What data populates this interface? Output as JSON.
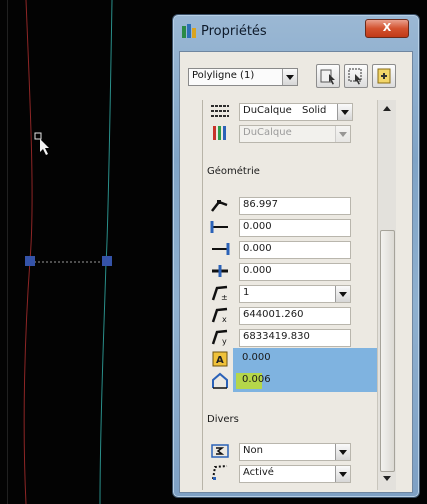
{
  "window": {
    "title": "Propriétés",
    "close_label": "X"
  },
  "toolbar": {
    "object_type": "Polyligne (1)",
    "buttons": [
      "quick-select-icon",
      "select-objects-icon",
      "toggle-pickadd-icon"
    ]
  },
  "general": {
    "rows": [
      {
        "icon": "linetype-icon",
        "value": "DuCalque",
        "extra": "Solid"
      },
      {
        "icon": "plotstyle-icon",
        "value": "DuCalque"
      }
    ]
  },
  "geometry": {
    "label": "Géométrie",
    "rows": [
      {
        "icon": "vertex-icon",
        "value": "86.997",
        "type": "text"
      },
      {
        "icon": "start-segment-width-icon",
        "value": "0.000",
        "type": "text"
      },
      {
        "icon": "end-segment-width-icon",
        "value": "0.000",
        "type": "text"
      },
      {
        "icon": "global-width-icon",
        "value": "0.000",
        "type": "text"
      },
      {
        "icon": "current-vertex-icon",
        "value": "1",
        "type": "select"
      },
      {
        "icon": "vertex-x-icon",
        "value": "644001.260",
        "type": "text"
      },
      {
        "icon": "vertex-y-icon",
        "value": "6833419.830",
        "type": "text"
      },
      {
        "icon": "area-icon",
        "value": "0.000",
        "type": "highlight"
      },
      {
        "icon": "length-icon",
        "value": "0.006",
        "type": "highlight-green"
      }
    ]
  },
  "misc": {
    "label": "Divers",
    "rows": [
      {
        "icon": "closed-icon",
        "value": "Non",
        "type": "select"
      },
      {
        "icon": "linetype-generation-icon",
        "value": "Activé",
        "type": "select"
      }
    ]
  },
  "colors": {
    "background": "#030303",
    "polyline_red": "#8e2626",
    "polyline_cyan": "#2a8f8a",
    "grip_blue": "#3553a8",
    "selection_highlight": "#7fb3e0",
    "green_value": "#b5d64a"
  }
}
